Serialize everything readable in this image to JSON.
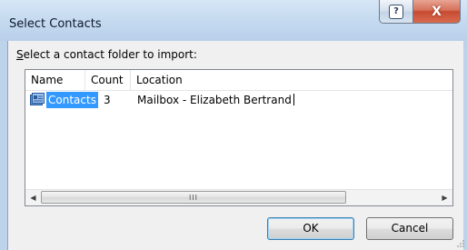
{
  "window": {
    "title": "Select Contacts"
  },
  "titlebar": {
    "help_icon": "?",
    "close_icon": "X"
  },
  "prompt": {
    "mnemonic": "S",
    "rest": "elect a contact folder to import:"
  },
  "list": {
    "columns": [
      "Name",
      "Count",
      "Location"
    ],
    "rows": [
      {
        "icon": "contacts-folder-icon",
        "name": "Contacts",
        "count": "3",
        "location": "Mailbox - Elizabeth Bertrand"
      }
    ],
    "scroll_thumb_grip": "III"
  },
  "buttons": {
    "ok": "OK",
    "cancel": "Cancel"
  },
  "colors": {
    "selection": "#3399ff",
    "titlebar": "#c4d9ef",
    "close": "#c64b32"
  }
}
